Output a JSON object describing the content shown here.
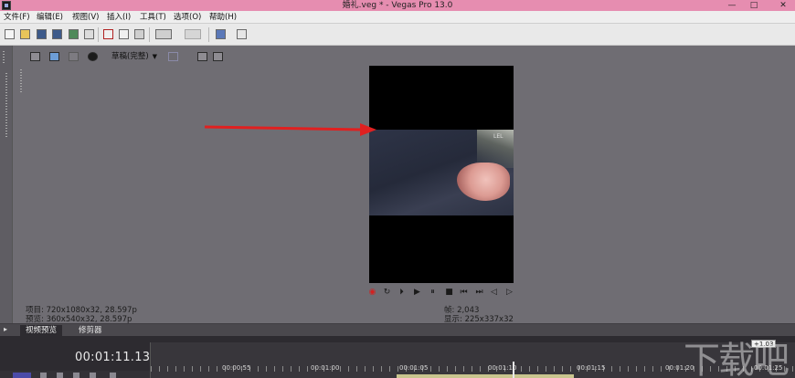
{
  "window": {
    "title": "婚礼.veg * - Vegas Pro 13.0",
    "controls": {
      "minimize": "—",
      "maximize": "□",
      "close": "✕"
    }
  },
  "menu": {
    "items": [
      "文件(F)",
      "编辑(E)",
      "视图(V)",
      "插入(I)",
      "工具(T)",
      "选项(O)",
      "帮助(H)"
    ]
  },
  "toolbar": {
    "icons": [
      "new-icon",
      "open-icon",
      "save-icon",
      "save-as-icon",
      "render-icon",
      "properties-icon",
      "cut-icon",
      "copy-icon",
      "paste-icon",
      "undo-icon",
      "redo-icon",
      "brush-icon",
      "help-icon"
    ]
  },
  "preview_toolbar": {
    "quality": "草稿(完整)"
  },
  "info": {
    "project": "项目: 720x1080x32, 28.597p",
    "preview": "预览: 360x540x32, 28.597p",
    "frame": "帧:    2,043",
    "display": "显示: 225x337x32"
  },
  "video": {
    "overlay_text": "LEL"
  },
  "tabs": [
    {
      "label": "视频预览",
      "active": true
    },
    {
      "label": "修剪器",
      "active": false
    }
  ],
  "timeline": {
    "timecode": "00:01:11.13",
    "rate": "+1.03",
    "ruler_labels": [
      "00:00:55",
      "00:01:00",
      "00:01:05",
      "00:01:10",
      "00:01:15",
      "00:01:20",
      "00:01:25"
    ]
  },
  "watermark": {
    "text": "下载吧"
  },
  "colors": {
    "titlebar": "#e68db0",
    "workspace": "#6f6d73",
    "timeline": "#2d2b30",
    "arrow": "#e02020"
  }
}
